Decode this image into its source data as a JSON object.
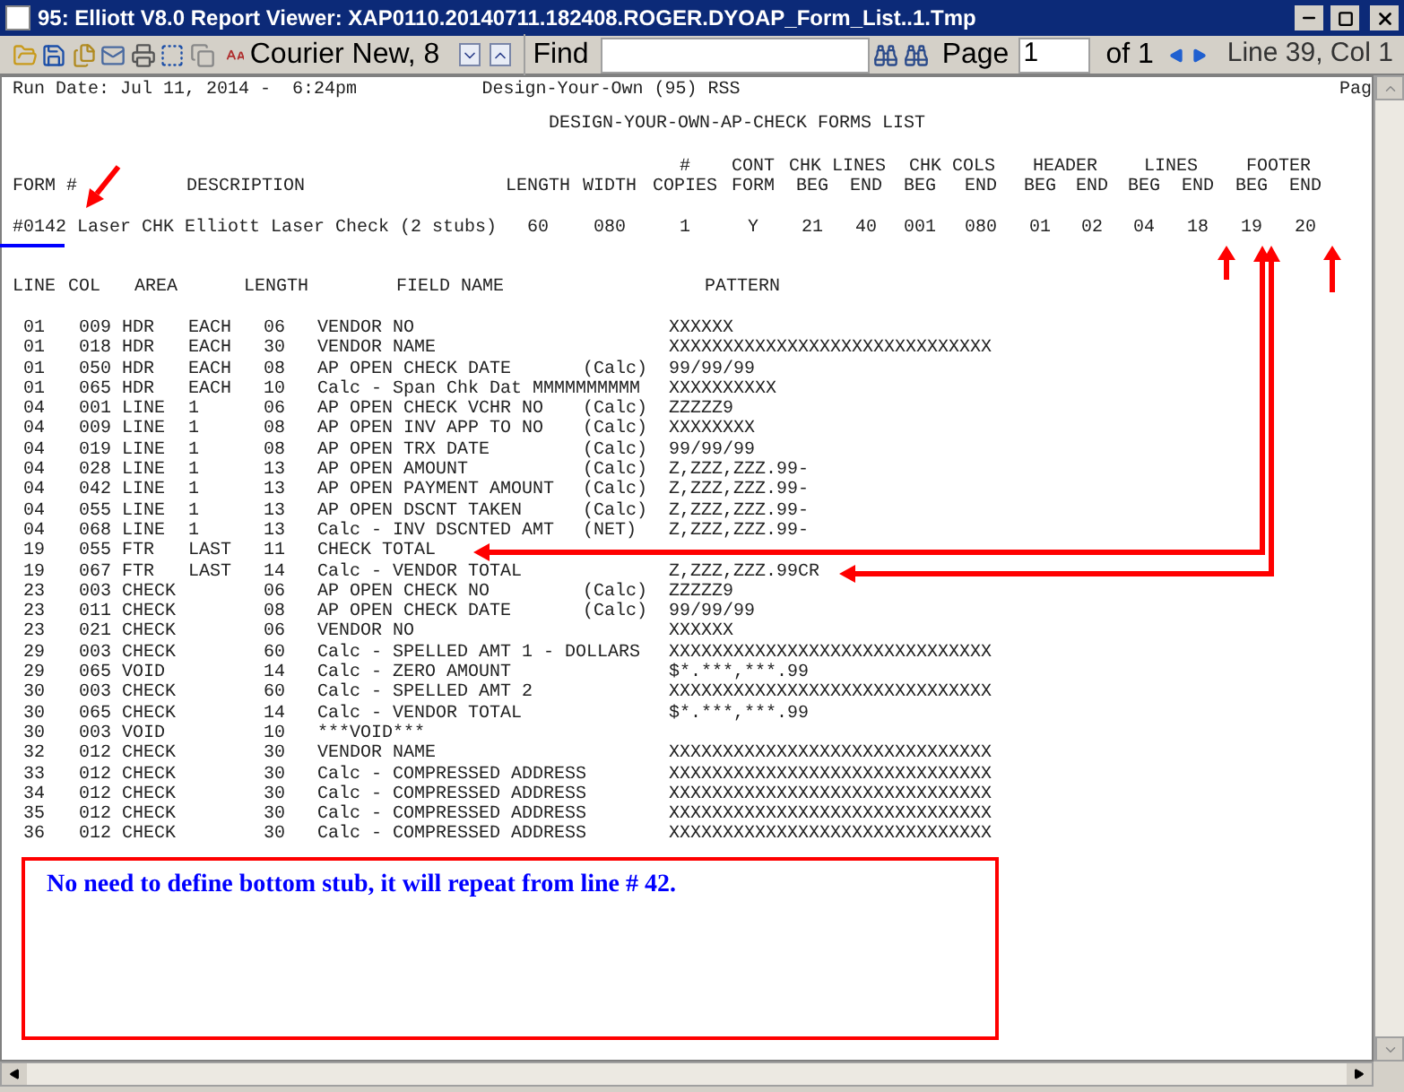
{
  "window": {
    "title": "95: Elliott V8.0 Report Viewer: XAP0110.20140711.182408.ROGER.DYOAP_Form_List..1.Tmp"
  },
  "toolbar": {
    "font": "Courier New, 8",
    "find_label": "Find",
    "page_label": "Page",
    "page_value": "1",
    "page_of": "of 1",
    "position": "Line 39, Col 1"
  },
  "report": {
    "run_date": "Run Date: Jul 11, 2014 -  6:24pm",
    "system": "Design-Your-Own (95) RSS",
    "page_cut": "Pag",
    "title": "DESIGN-YOUR-OWN-AP-CHECK FORMS LIST",
    "form_headers": {
      "form": "FORM #",
      "description": "DESCRIPTION",
      "groups": [
        {
          "kind": "blank"
        },
        {
          "label": "#",
          "kind": "single"
        },
        {
          "label": "CONT",
          "kind": "single"
        },
        {
          "label": "CHK LINES",
          "kind": "pair"
        },
        {
          "label": "CHK COLS",
          "kind": "pair"
        },
        {
          "label": "HEADER",
          "kind": "pair"
        },
        {
          "label": "LINES",
          "kind": "pair"
        },
        {
          "label": "FOOTER",
          "kind": "pair"
        }
      ],
      "columns": [
        "LENGTH",
        "WIDTH",
        "COPIES",
        "FORM",
        "BEG",
        "END",
        "BEG",
        "END",
        "BEG",
        "END",
        "BEG",
        "END",
        "BEG",
        "END"
      ]
    },
    "form_rows": [
      {
        "form": "#0142",
        "description": "Laser CHK Elliott Laser Check (2 stubs)",
        "values": [
          "60",
          "080",
          "1",
          "Y",
          "21",
          "40",
          "001",
          "080",
          "01",
          "02",
          "04",
          "18",
          "19",
          "20"
        ]
      }
    ],
    "field_columns": [
      "LINE",
      "COL",
      "AREA",
      "LENGTH",
      "FIELD NAME",
      "PATTERN"
    ],
    "fields": [
      {
        "line": "01",
        "col": "009",
        "area": "HDR",
        "occurs": "EACH",
        "length": "06",
        "field": "VENDOR NO",
        "pattern": "XXXXXX"
      },
      {
        "line": "01",
        "col": "018",
        "area": "HDR",
        "occurs": "EACH",
        "length": "30",
        "field": "VENDOR NAME",
        "pattern": "XXXXXXXXXXXXXXXXXXXXXXXXXXXXXX"
      },
      {
        "line": "01",
        "col": "050",
        "area": "HDR",
        "occurs": "EACH",
        "length": "08",
        "field": "AP OPEN CHECK DATE",
        "note": "(Calc)",
        "pattern": "99/99/99"
      },
      {
        "line": "01",
        "col": "065",
        "area": "HDR",
        "occurs": "EACH",
        "length": "10",
        "field": "Calc - Span Chk Dat MMMMMMMMMM",
        "pattern": "XXXXXXXXXX"
      },
      {
        "line": "04",
        "col": "001",
        "area": "LINE",
        "occurs": "1",
        "length": "06",
        "field": "AP OPEN CHECK VCHR NO",
        "note": "(Calc)",
        "pattern": "ZZZZZ9"
      },
      {
        "line": "04",
        "col": "009",
        "area": "LINE",
        "occurs": "1",
        "length": "08",
        "field": "AP OPEN INV APP TO NO",
        "note": "(Calc)",
        "pattern": "XXXXXXXX"
      },
      {
        "line": "04",
        "col": "019",
        "area": "LINE",
        "occurs": "1",
        "length": "08",
        "field": "AP OPEN TRX DATE",
        "note": "(Calc)",
        "pattern": "99/99/99"
      },
      {
        "line": "04",
        "col": "028",
        "area": "LINE",
        "occurs": "1",
        "length": "13",
        "field": "AP OPEN AMOUNT",
        "note": "(Calc)",
        "pattern": "Z,ZZZ,ZZZ.99-"
      },
      {
        "line": "04",
        "col": "042",
        "area": "LINE",
        "occurs": "1",
        "length": "13",
        "field": "AP OPEN PAYMENT AMOUNT",
        "note": "(Calc)",
        "pattern": "Z,ZZZ,ZZZ.99-"
      },
      {
        "line": "04",
        "col": "055",
        "area": "LINE",
        "occurs": "1",
        "length": "13",
        "field": "AP OPEN DSCNT TAKEN",
        "note": "(Calc)",
        "pattern": "Z,ZZZ,ZZZ.99-"
      },
      {
        "line": "04",
        "col": "068",
        "area": "LINE",
        "occurs": "1",
        "length": "13",
        "field": "Calc - INV DSCNTED AMT",
        "note": "(NET)",
        "pattern": "Z,ZZZ,ZZZ.99-"
      },
      {
        "line": "19",
        "col": "055",
        "area": "FTR",
        "occurs": "LAST",
        "length": "11",
        "field": "CHECK TOTAL"
      },
      {
        "line": "19",
        "col": "067",
        "area": "FTR",
        "occurs": "LAST",
        "length": "14",
        "field": "Calc - VENDOR TOTAL",
        "pattern": "Z,ZZZ,ZZZ.99CR"
      },
      {
        "line": "23",
        "col": "003",
        "area": "CHECK",
        "length": "06",
        "field": "AP OPEN CHECK NO",
        "note": "(Calc)",
        "pattern": "ZZZZZ9"
      },
      {
        "line": "23",
        "col": "011",
        "area": "CHECK",
        "length": "08",
        "field": "AP OPEN CHECK DATE",
        "note": "(Calc)",
        "pattern": "99/99/99"
      },
      {
        "line": "23",
        "col": "021",
        "area": "CHECK",
        "length": "06",
        "field": "VENDOR NO",
        "pattern": "XXXXXX"
      },
      {
        "line": "29",
        "col": "003",
        "area": "CHECK",
        "length": "60",
        "field": "Calc - SPELLED AMT 1 - DOLLARS",
        "pattern": "XXXXXXXXXXXXXXXXXXXXXXXXXXXXXX"
      },
      {
        "line": "29",
        "col": "065",
        "area": "VOID",
        "length": "14",
        "field": "Calc - ZERO AMOUNT",
        "pattern": "$*.***,***.99"
      },
      {
        "line": "30",
        "col": "003",
        "area": "CHECK",
        "length": "60",
        "field": "Calc - SPELLED AMT 2",
        "pattern": "XXXXXXXXXXXXXXXXXXXXXXXXXXXXXX"
      },
      {
        "line": "30",
        "col": "065",
        "area": "CHECK",
        "length": "14",
        "field": "Calc - VENDOR TOTAL",
        "pattern": "$*.***,***.99"
      },
      {
        "line": "30",
        "col": "003",
        "area": "VOID",
        "length": "10",
        "field": "***VOID***"
      },
      {
        "line": "32",
        "col": "012",
        "area": "CHECK",
        "length": "30",
        "field": "VENDOR NAME",
        "pattern": "XXXXXXXXXXXXXXXXXXXXXXXXXXXXXX"
      },
      {
        "line": "33",
        "col": "012",
        "area": "CHECK",
        "length": "30",
        "field": "Calc - COMPRESSED ADDRESS",
        "pattern": "XXXXXXXXXXXXXXXXXXXXXXXXXXXXXX"
      },
      {
        "line": "34",
        "col": "012",
        "area": "CHECK",
        "length": "30",
        "field": "Calc - COMPRESSED ADDRESS",
        "pattern": "XXXXXXXXXXXXXXXXXXXXXXXXXXXXXX"
      },
      {
        "line": "35",
        "col": "012",
        "area": "CHECK",
        "length": "30",
        "field": "Calc - COMPRESSED ADDRESS",
        "pattern": "XXXXXXXXXXXXXXXXXXXXXXXXXXXXXX"
      },
      {
        "line": "36",
        "col": "012",
        "area": "CHECK",
        "length": "30",
        "field": "Calc - COMPRESSED ADDRESS",
        "pattern": "XXXXXXXXXXXXXXXXXXXXXXXXXXXXXX"
      }
    ]
  },
  "callout": {
    "text": "No need to define bottom stub, it will repeat from line # 42."
  }
}
